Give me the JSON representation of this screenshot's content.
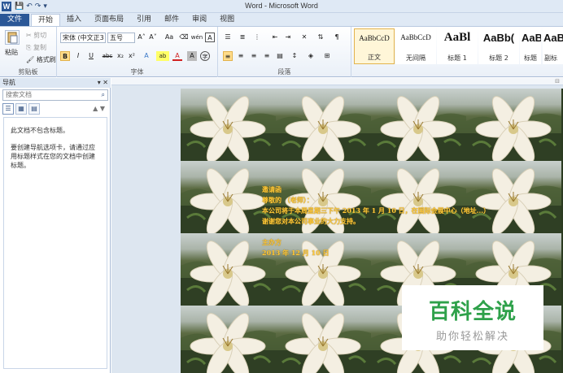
{
  "titlebar": {
    "logo": "W",
    "qat": [
      "💾",
      "↶",
      "↷",
      "▾"
    ],
    "title": "Word - Microsoft Word"
  },
  "tabs": {
    "file": "文件",
    "items": [
      "开始",
      "插入",
      "页面布局",
      "引用",
      "邮件",
      "审阅",
      "视图"
    ]
  },
  "ribbon": {
    "clipboard": {
      "label": "剪贴板",
      "paste": "粘贴",
      "cut": "剪切",
      "copy": "复制",
      "format_painter": "格式刷"
    },
    "font": {
      "label": "字体",
      "font_name": "宋体 (中文正3 -",
      "font_size": "五号",
      "grow": "A˄",
      "shrink": "A˅",
      "case": "Aa",
      "clear": "⌫",
      "phonetic": "wén",
      "border": "A",
      "bold": "B",
      "italic": "I",
      "underline": "U",
      "strike": "abc",
      "sub": "x₂",
      "sup": "x²",
      "effects": "A",
      "highlight": "ab",
      "color": "A",
      "shade": "A",
      "circle": "字"
    },
    "paragraph": {
      "label": "段落"
    },
    "styles": {
      "items": [
        {
          "sample": "AaBbCcD",
          "name": "正文",
          "selected": true
        },
        {
          "sample": "AaBbCcD",
          "name": "无间隔",
          "selected": false
        },
        {
          "sample": "AaBl",
          "name": "标题 1",
          "selected": false
        },
        {
          "sample": "AaBb(",
          "name": "标题 2",
          "selected": false
        },
        {
          "sample": "AaBb(",
          "name": "标题",
          "selected": false
        },
        {
          "sample": "AaBl",
          "name": "副标",
          "selected": false
        }
      ]
    }
  },
  "nav": {
    "title": "导航",
    "controls": "▾ ✕",
    "search_placeholder": "搜索文档",
    "views": [
      "☰",
      "▦",
      "▤"
    ],
    "arrows": "▲ ▼",
    "message1": "此文档不包含标题。",
    "message2": "要创建导航选项卡，请通过应用标题样式在您的文档中创建标题。"
  },
  "document": {
    "lines": [
      "邀请函",
      "尊敬的          （老师）：",
      "本公司将于本周星期三下午 2013 年 1 月 10 日，在国际会展中心（地址...）",
      "谢谢您对本公司事业的大力支持。",
      "",
      "主办方",
      "2013 年 12 月 10 日"
    ]
  },
  "watermark": {
    "main": "百科全说",
    "sub": "助你轻松解决"
  },
  "colors": {
    "accent": "#2b5797",
    "doc_text": "#ffc93a",
    "watermark_green": "#2ea14a"
  }
}
